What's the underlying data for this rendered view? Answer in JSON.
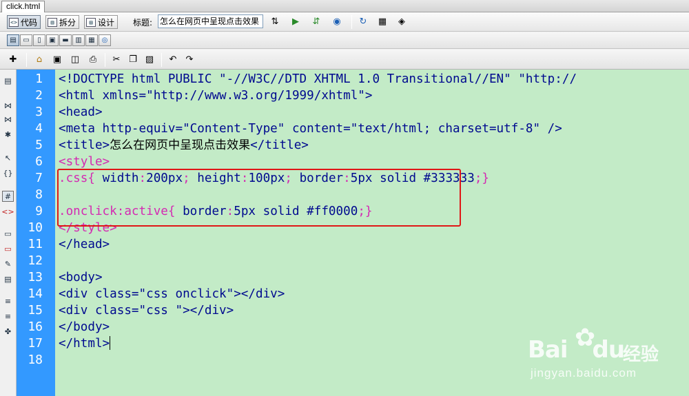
{
  "tab": {
    "filename": "click.html"
  },
  "toolbar": {
    "view_code": "代码",
    "view_split": "拆分",
    "view_design": "设计",
    "title_label": "标题:",
    "title_value": "怎么在网页中呈现点击效果"
  },
  "editor": {
    "line_numbers": [
      "1",
      "2",
      "3",
      "4",
      "5",
      "6",
      "7",
      "8",
      "9",
      "10",
      "11",
      "12",
      "13",
      "14",
      "15",
      "16",
      "17",
      "18"
    ],
    "lines": [
      "<!DOCTYPE html PUBLIC \"-//W3C//DTD XHTML 1.0 Transitional//EN\" \"http://",
      "<html xmlns=\"http://www.w3.org/1999/xhtml\">",
      "<head>",
      "<meta http-equiv=\"Content-Type\" content=\"text/html; charset=utf-8\" />",
      "<title>",
      "怎么在网页中呈现点击效果",
      "</title>",
      "<style>",
      ".css{ ",
      "width",
      ":",
      "200px",
      "; ",
      "height",
      ":",
      "100px",
      "; ",
      "border",
      ":",
      "5px solid #333333",
      ";}",
      "",
      ".onclick:active{ ",
      "border",
      ":",
      "5px solid #ff0000",
      ";}",
      "</style>",
      "</head>",
      "",
      "<body>",
      "<div class=\"css onclick\"></div>",
      "<div class=\"css \"></div>",
      "</body>",
      "</html>",
      ""
    ]
  },
  "watermark": {
    "logo": "Bai",
    "logo2": "du",
    "brand_cn": "经验",
    "url": "jingyan.baidu.com"
  },
  "colors": {
    "gutter": "#3399ff",
    "editor_bg": "#c3ebc7",
    "tag": "#000a8f",
    "css_selector": "#d42ab2",
    "highlight_box": "#e01616"
  }
}
